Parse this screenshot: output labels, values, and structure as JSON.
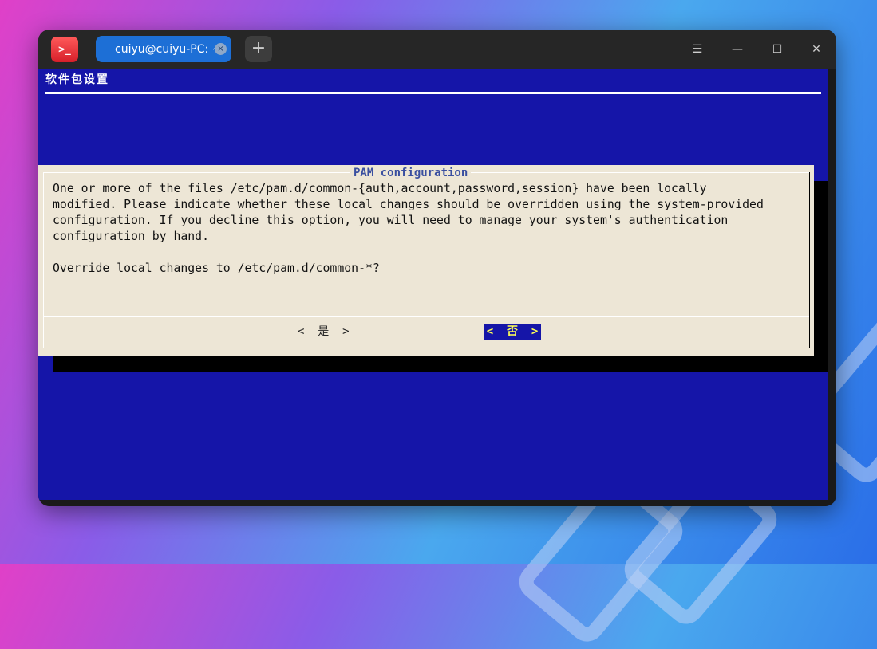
{
  "titlebar": {
    "app_icon": ">_",
    "tab_label": "cuiyu@cuiyu-PC: ~",
    "tab_close": "×",
    "new_tab": "+",
    "menu_icon": "☰",
    "minimize_icon": "—",
    "maximize_icon": "☐",
    "close_icon": "✕"
  },
  "terminal": {
    "screen_title": "软件包设置",
    "dialog": {
      "title": "PAM configuration",
      "body": "One or more of the files /etc/pam.d/common-{auth,account,password,session} have been locally\nmodified. Please indicate whether these local changes should be overridden using the system-provided\nconfiguration. If you decline this option, you will need to manage your system's authentication\nconfiguration by hand.\n\nOverride local changes to /etc/pam.d/common-*?",
      "yes_button": "<  是  >",
      "no_button": "<  否  >"
    }
  },
  "colors": {
    "terminal_bg": "#1515a8",
    "dialog_bg": "#ede6d6",
    "dialog_title": "#3a4fa0",
    "selected_button_text": "#ffff55",
    "tab_active": "#1d6fd6"
  }
}
